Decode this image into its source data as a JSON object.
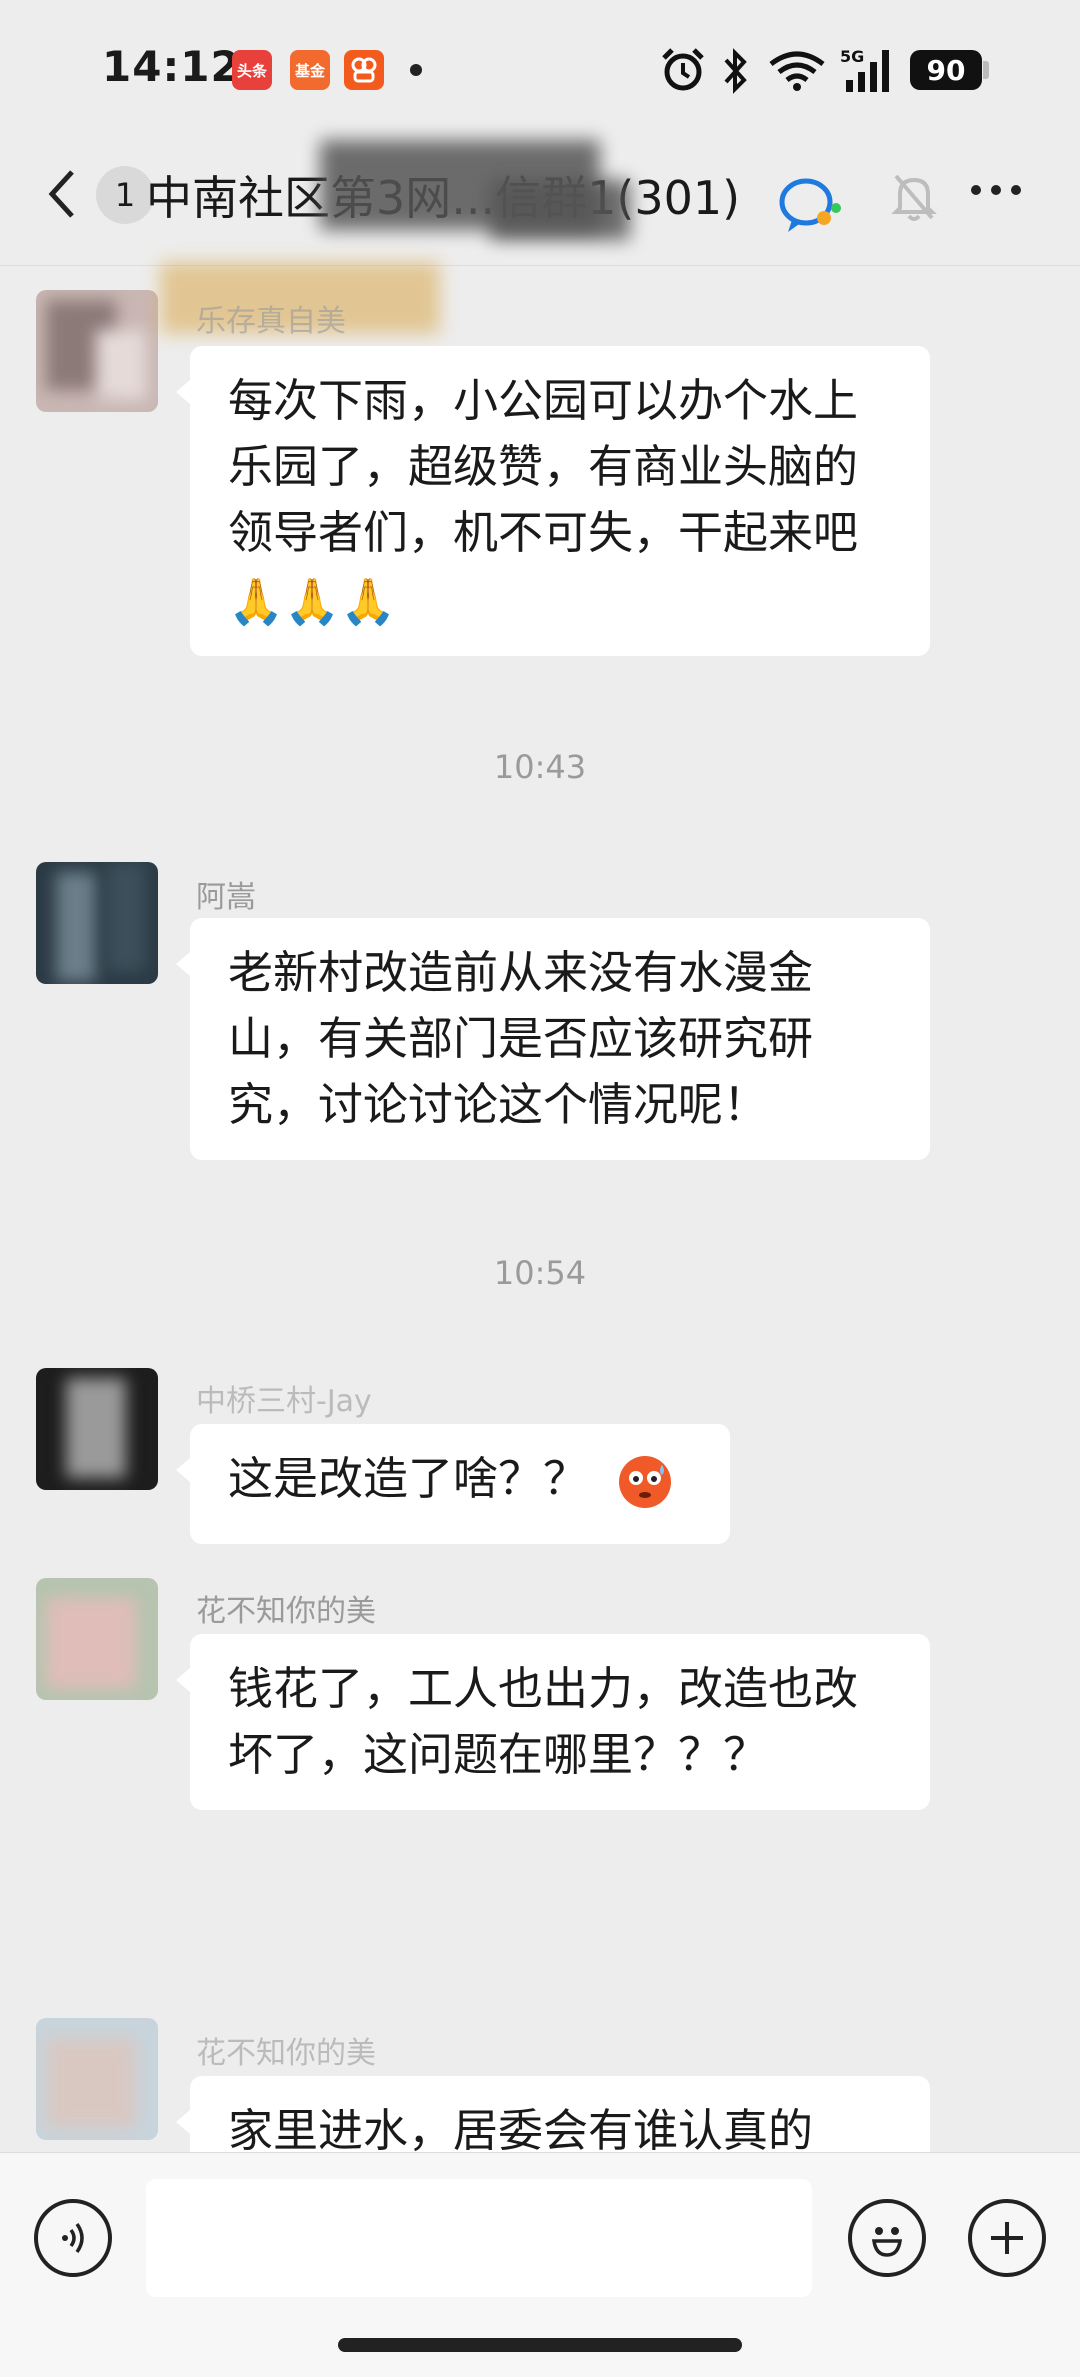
{
  "status_bar": {
    "time": "14:12",
    "app_icons": [
      {
        "name": "toutiao",
        "label": "头条",
        "color": "#e8403b"
      },
      {
        "name": "fund",
        "label": "基金",
        "color": "#f26a2e"
      },
      {
        "name": "kuaishou",
        "label": "",
        "color": "#f25b1d"
      }
    ],
    "network": "5G",
    "battery": "90"
  },
  "header": {
    "unread_count": "1",
    "title": "中南社区第3网...信群1(301)"
  },
  "messages": [
    {
      "sender": "乐存真自美",
      "text": "每次下雨，小公园可以办个水上乐园了，超级赞，有商业头脑的领导者们，机不可失，干起来吧",
      "emoji": "🙏🙏🙏"
    },
    {
      "timestamp": "10:43"
    },
    {
      "sender": "阿嵩",
      "text": "老新村改造前从来没有水漫金山，有关部门是否应该研究研究，讨论讨论这个情况呢！"
    },
    {
      "timestamp": "10:54"
    },
    {
      "sender": "中桥三村-Jay",
      "text": "这是改造了啥？？",
      "emoji": "😳"
    },
    {
      "sender": "花不知你的美",
      "text": "钱花了，工人也出力，改造也改坏了，这问题在哪里？？？"
    },
    {
      "sender": "花不知你的美",
      "text": "家里进水，居委会有谁认真的"
    }
  ],
  "input_bar": {
    "voice_icon": "voice-icon",
    "emoji_icon": "emoji-icon",
    "plus_icon": "plus-icon"
  },
  "colors": {
    "background": "#ededed",
    "bubble": "#ffffff",
    "sender": "#9a9a9a",
    "accent_blue": "#1f7ae0"
  }
}
